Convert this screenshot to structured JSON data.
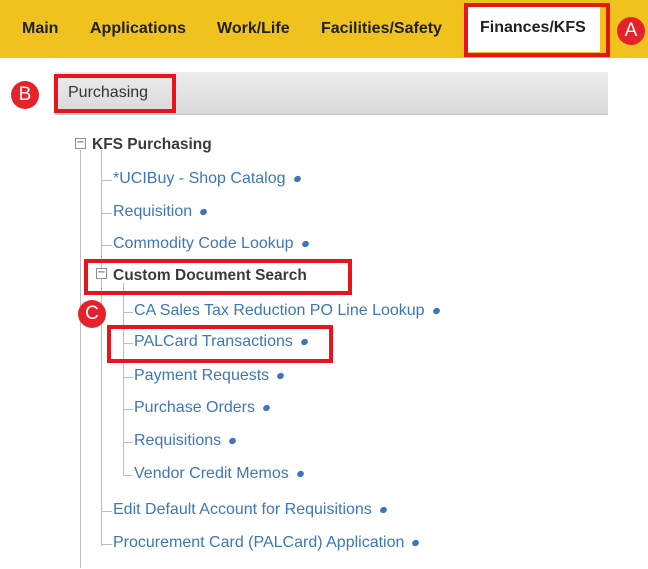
{
  "nav": {
    "items": [
      "Main",
      "Applications",
      "Work/Life",
      "Facilities/Safety",
      "Finances/KFS"
    ],
    "active_index": 4
  },
  "section": {
    "title": "Purchasing"
  },
  "tree": {
    "root": "KFS Purchasing",
    "items": [
      "*UCIBuy - Shop Catalog",
      "Requisition",
      "Commodity Code Lookup"
    ],
    "subfolder": {
      "title": "Custom Document Search",
      "items": [
        "CA Sales Tax Reduction PO Line Lookup",
        "PALCard Transactions",
        "Payment Requests",
        "Purchase Orders",
        "Requisitions",
        "Vendor Credit Memos"
      ]
    },
    "items_after": [
      "Edit Default Account for Requisitions",
      "Procurement Card (PALCard) Application"
    ]
  },
  "markers": {
    "a": "A",
    "b": "B",
    "c": "C"
  },
  "colors": {
    "nav_background": "#f0c21e",
    "highlight_box": "#e8141b",
    "marker": "#e5222a",
    "link": "#3d76ba"
  }
}
